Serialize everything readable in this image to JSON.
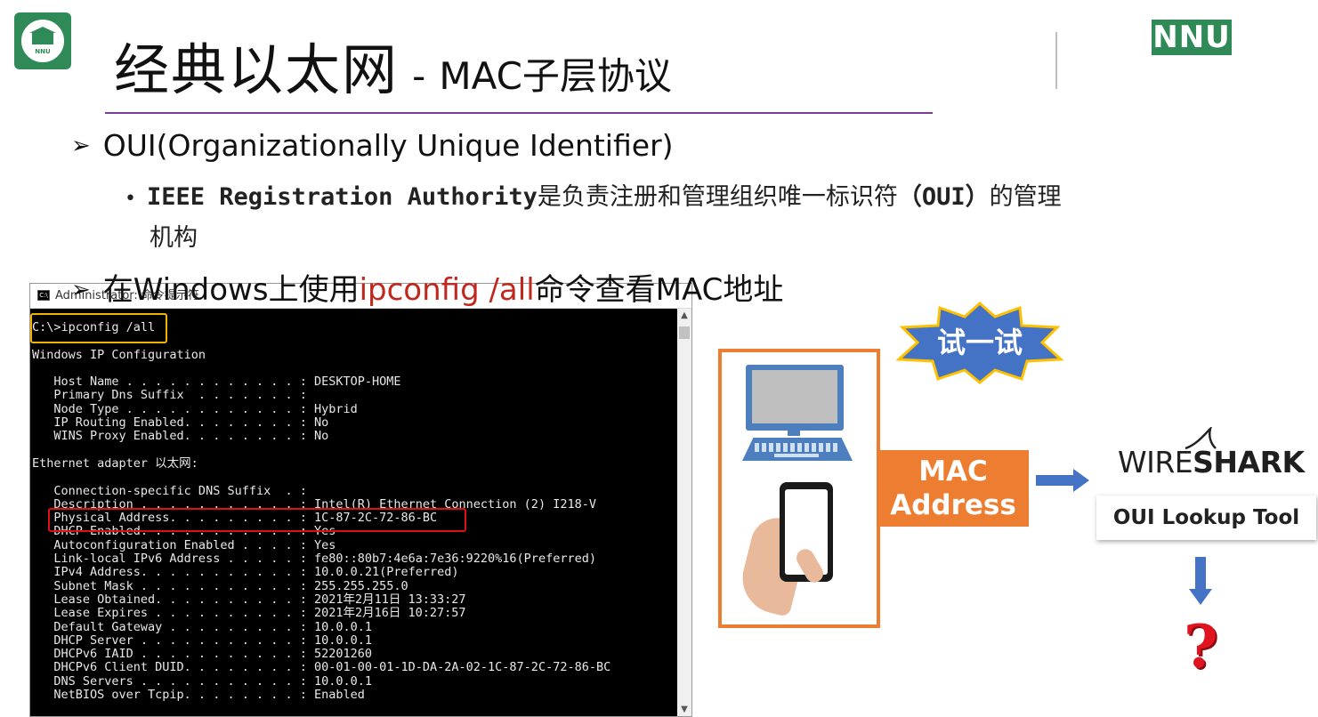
{
  "header": {
    "title_main": "经典以太网",
    "title_sep": "-",
    "title_sub": "MAC子层协议",
    "brand_badge": "NNU",
    "logo_text": "NNU"
  },
  "bullets": {
    "b1_marker": "➢",
    "b1_text": "OUI(Organizationally Unique Identifier)",
    "b2_marker": "•",
    "b2_mono": "IEEE Registration Authority",
    "b2_text": "是负责注册和管理组织唯一标识符",
    "b2_mono2": "（OUI）",
    "b2_tail": "的管理",
    "b2_line2": "机构",
    "b3_marker": "➢",
    "b3_pre": "在Windows上使用",
    "b3_red": "ipconfig /all",
    "b3_post": "命令查看MAC地址"
  },
  "cmd": {
    "title": "Administrator: 命令提示符",
    "lines": "C:\\>ipconfig /all\n\nWindows IP Configuration\n\n   Host Name . . . . . . . . . . . . : DESKTOP-HOME\n   Primary Dns Suffix  . . . . . . . :\n   Node Type . . . . . . . . . . . . : Hybrid\n   IP Routing Enabled. . . . . . . . : No\n   WINS Proxy Enabled. . . . . . . . : No\n\nEthernet adapter 以太网:\n\n   Connection-specific DNS Suffix  . :\n   Description . . . . . . . . . . . : Intel(R) Ethernet Connection (2) I218-V\n   Physical Address. . . . . . . . . : 1C-87-2C-72-86-BC\n   DHCP Enabled. . . . . . . . . . . : Yes\n   Autoconfiguration Enabled . . . . : Yes\n   Link-local IPv6 Address . . . . . : fe80::80b7:4e6a:7e36:9220%16(Preferred)\n   IPv4 Address. . . . . . . . . . . : 10.0.0.21(Preferred)\n   Subnet Mask . . . . . . . . . . . : 255.255.255.0\n   Lease Obtained. . . . . . . . . . : 2021年2月11日 13:33:27\n   Lease Expires . . . . . . . . . . : 2021年2月16日 10:27:57\n   Default Gateway . . . . . . . . . : 10.0.0.1\n   DHCP Server . . . . . . . . . . . : 10.0.0.1\n   DHCPv6 IAID . . . . . . . . . . . : 52201260\n   DHCPv6 Client DUID. . . . . . . . : 00-01-00-01-1D-DA-2A-02-1C-87-2C-72-86-BC\n   DNS Servers . . . . . . . . . . . : 10.0.0.1\n   NetBIOS over Tcpip. . . . . . . . : Enabled"
  },
  "diagram": {
    "badge": "试一试",
    "mac_line1": "MAC",
    "mac_line2": "Address",
    "wire_a": "WIRE",
    "wire_b": "SHARK",
    "oui_tool": "OUI Lookup Tool",
    "question": "?"
  },
  "colors": {
    "accent_orange": "#ed7d31",
    "arrow_blue": "#4472c4",
    "brand_green": "#2f8a57",
    "title_rule": "#7a3e96",
    "highlight_red": "#c0281e"
  }
}
